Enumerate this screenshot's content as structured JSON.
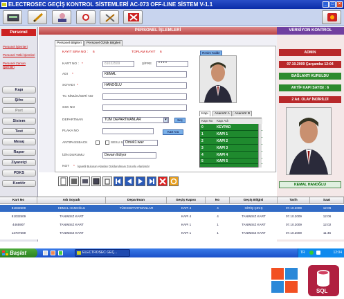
{
  "window": {
    "title": "ELECTROSEC GEÇİŞ KONTROL SİSTEMLERİ AC-073 OFF-LINE SİSTEM V-1.1"
  },
  "left": {
    "header": "Personel",
    "links": [
      "Personel İşlemleri",
      "Personel Yetki İşlemleri",
      "Personel Zaman İşlemleri"
    ],
    "buttons": [
      "Kapı",
      "Şifre",
      "Port",
      "Sistem",
      "Test",
      "Mesaj",
      "Rapor",
      "Ziyaretçi",
      "PDKS",
      "Kontör"
    ]
  },
  "center": {
    "header": "PERSONEL İŞLEMLERİ",
    "tabs": [
      "Personel Bilgileri",
      "Personel Özlük Bilgileri"
    ],
    "kayit_sira_label": "KAYIT SIRA NO :",
    "kayit_sira_value": "6",
    "toplam_label": "TOPLAM KAYIT",
    "toplam_value": "6",
    "kart_no_label": "KART NO :",
    "kart_no_value": "81032509",
    "sifre_label": "ŞİFRE",
    "sifre_value": "* * * *",
    "adi_label": "ADI",
    "adi_value": "KEMAL",
    "soyadi_label": "SOYADI",
    "soyadi_value": "HANOĞLU",
    "tc_label": "TC KİMLİK/SERİ NO",
    "ssk_label": "SSK NO",
    "departman_label": "DEPARTMAN",
    "departman_value": "TÜM DEPARTMANLAR",
    "sec_button": "Seç",
    "plaka_label": "PLAKA NO",
    "kart_ara_button": "Kart Ara",
    "antipassback_label": "ANTIPASSBACK",
    "sesli_uyari_label": "SESLI UYARI",
    "sesli_uyari_value": "Ornek1.wav",
    "izin_label": "İZİN DURUMU",
    "izin_value": "Devam Ediyor",
    "not_label": "NOT",
    "not_text": "İşaretli Bulunan Alanları Doldurulması Zorunlu Alanlardır",
    "resim_button": "Resim Kaldır",
    "kapi_tabs": [
      "Kapı",
      "Asansör A",
      "Asansör B"
    ],
    "kapi_cols": [
      "Kapı No",
      "Kapı Adı"
    ],
    "kapi_rows": [
      {
        "no": "0",
        "name": "KEYPAD"
      },
      {
        "no": "1",
        "name": "KAPI 1"
      },
      {
        "no": "2",
        "name": "KAPI 2"
      },
      {
        "no": "3",
        "name": "KAPI 3"
      },
      {
        "no": "4",
        "name": "KAPI 4"
      },
      {
        "no": "5",
        "name": "KAPI 5"
      }
    ]
  },
  "right": {
    "header": "VERSİYON KONTROL",
    "boxes": [
      {
        "text": "ADMIN",
        "color": "#b8282a"
      },
      {
        "text": "07.10.2009 Çarşamba 12:04",
        "color": "#b8282a"
      },
      {
        "text": "BAĞLANTI KURULDU",
        "color": "#2e8a2e"
      },
      {
        "text": "AKTİF KAPI SAYISI : 6",
        "color": "#2e8a2e"
      },
      {
        "text": "2 Ad. OLAY İNDİRİLDİ",
        "color": "#b8282a"
      }
    ],
    "name": "KEMAL HANOĞLU"
  },
  "table": {
    "columns": [
      "Kart No",
      "Adı Soyadı",
      "Departman",
      "Geçiş Kapısı",
      "No",
      "Geçiş Bilgisi",
      "Tarih",
      "Saat"
    ],
    "rows": [
      [
        "81032509",
        "KEMAL HANOĞLU",
        "TÜM DEPARTMANLAR",
        "KAPI 4",
        "4",
        "GİRİŞ-ÇIKIŞ",
        "07.10.2009",
        "12:06"
      ],
      [
        "81032509",
        "TANIMSIZ KART",
        "",
        "KAPI 4",
        "4",
        "TANIMSIZ KART",
        "07.10.2009",
        "12:06"
      ],
      [
        "4465907",
        "TANIMSIZ KART",
        "",
        "KAPI 1",
        "1",
        "TANIMSIZ KART",
        "07.10.2009",
        "12:02"
      ],
      [
        "13707569",
        "TANIMSIZ KART",
        "",
        "KAPI 1",
        "1",
        "TANIMSIZ KART",
        "07.10.2009",
        "11:46"
      ]
    ]
  },
  "taskbar": {
    "start": "Başlat",
    "task": "ELECTROSEC GEÇ...",
    "lang": "TR",
    "clock": "12:04"
  }
}
